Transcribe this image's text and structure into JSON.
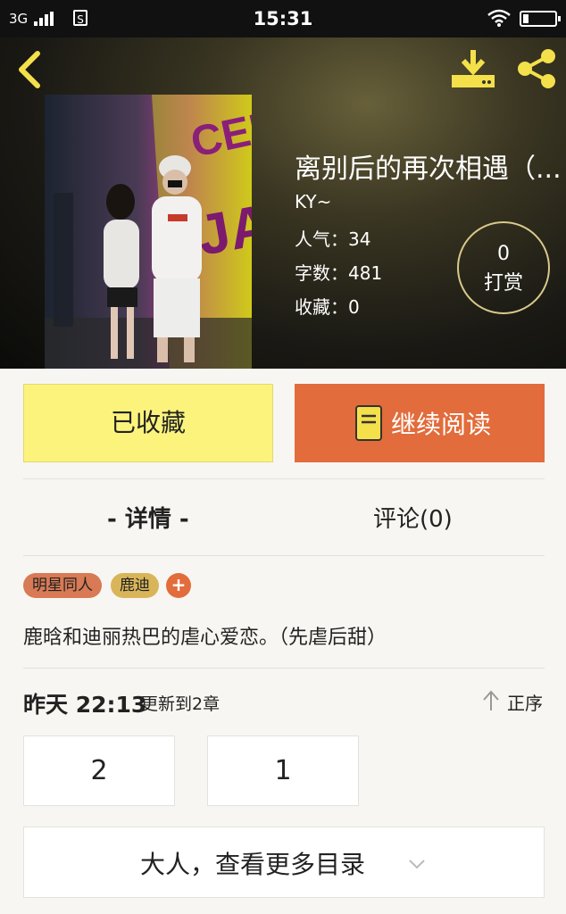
{
  "status_bar": {
    "network": "3G",
    "sim": "S",
    "time": "15:31"
  },
  "book": {
    "title": "离别后的再次相遇（...",
    "author": "KY~",
    "popularity": "人气：34",
    "word_count": "字数：481",
    "favorites": "收藏：0",
    "reward_count": "0",
    "reward_label": "打赏"
  },
  "actions": {
    "favorite_label": "已收藏",
    "read_label": "继续阅读"
  },
  "tabs": {
    "details": "- 详情 -",
    "comments": "评论(0)"
  },
  "tags": [
    "明星同人",
    "鹿迪"
  ],
  "add_tag_label": "+",
  "description": "鹿晗和迪丽热巴的虐心爱恋。（先虐后甜）",
  "update": {
    "time": "昨天 22:13",
    "text": "更新到2章",
    "order_label": "正序"
  },
  "chapters": [
    "2",
    "1"
  ],
  "more_catalog_label": "大人，查看更多目录",
  "colors": {
    "accent": "#e26c3b",
    "favorite_bg": "#fbf37c",
    "tag_1": "#d87a55",
    "tag_2": "#d9b55a"
  },
  "icons": [
    "back-icon",
    "download-icon",
    "share-icon",
    "book-icon",
    "up-arrow-icon",
    "chevron-down-icon",
    "wifi-icon",
    "battery-icon",
    "signal-icon"
  ]
}
